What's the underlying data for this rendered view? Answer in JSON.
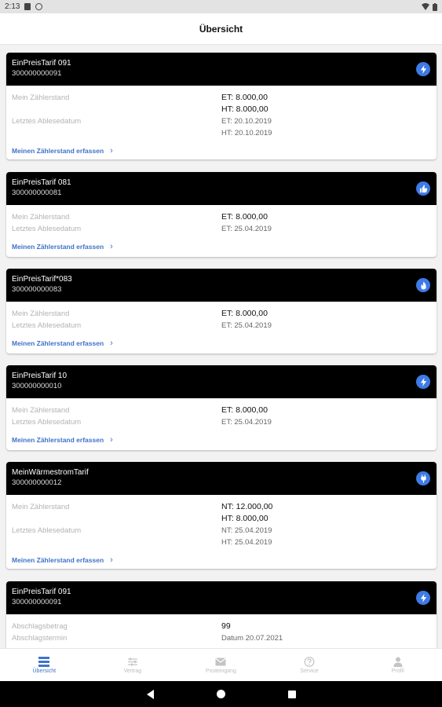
{
  "status_bar": {
    "time": "2:13"
  },
  "header": {
    "title": "Übersicht"
  },
  "cards": [
    {
      "tariff": "EinPreisTarif 091",
      "number": "300000000091",
      "icon": "lightning-icon",
      "label_reading": "Mein Zählerstand",
      "label_date": "Letztes Ablesedatum",
      "reading_1": "ET: 8.000,00",
      "reading_2": "HT: 8.000,00",
      "date_1": "ET: 20.10.2019",
      "date_2": "HT: 20.10.2019",
      "link": "Meinen Zählerstand erfassen"
    },
    {
      "tariff": "EinPreisTarif 081",
      "number": "300000000081",
      "icon": "thumbs-up-icon",
      "label_reading": "Mein Zählerstand",
      "label_date": "Letztes Ablesedatum",
      "reading_1": "ET: 8.000,00",
      "date_1": "ET: 25.04.2019",
      "link": "Meinen Zählerstand erfassen"
    },
    {
      "tariff": "EinPreisTarif*083",
      "number": "300000000083",
      "icon": "flame-icon",
      "label_reading": "Mein Zählerstand",
      "label_date": "Letztes Ablesedatum",
      "reading_1": "ET: 8.000,00",
      "date_1": "ET: 25.04.2019",
      "link": "Meinen Zählerstand erfassen"
    },
    {
      "tariff": "EinPreisTarif 10",
      "number": "300000000010",
      "icon": "lightning-icon",
      "label_reading": "Mein Zählerstand",
      "label_date": "Letztes Ablesedatum",
      "reading_1": "ET: 8.000,00",
      "date_1": "ET: 25.04.2019",
      "link": "Meinen Zählerstand erfassen"
    },
    {
      "tariff": "MeinWärmestromTarif",
      "number": "300000000012",
      "icon": "plug-icon",
      "label_reading": "Mein Zählerstand",
      "label_date": "Letztes Ablesedatum",
      "reading_1": "NT: 12.000,00",
      "reading_2": "HT: 8.000,00",
      "date_1": "NT: 25.04.2019",
      "date_2": "HT: 25.04.2019",
      "link": "Meinen Zählerstand erfassen"
    },
    {
      "tariff": "EinPreisTarif 091",
      "number": "300000000091",
      "icon": "lightning-icon",
      "label_amount": "Abschlagsbetrag",
      "label_due": "Abschlagstermin",
      "amount": "99",
      "due_date": "Datum 20.07.2021"
    }
  ],
  "tabs": [
    {
      "label": "Übersicht",
      "icon": "overview-icon",
      "active": true
    },
    {
      "label": "Vertrag",
      "icon": "contract-icon"
    },
    {
      "label": "Posteingang",
      "icon": "mail-icon"
    },
    {
      "label": "Service",
      "icon": "help-icon"
    },
    {
      "label": "Profil",
      "icon": "profile-icon"
    }
  ],
  "colors": {
    "accent": "#3f73c9",
    "icon_bg": "#3d7be6",
    "card_header": "#000000"
  }
}
